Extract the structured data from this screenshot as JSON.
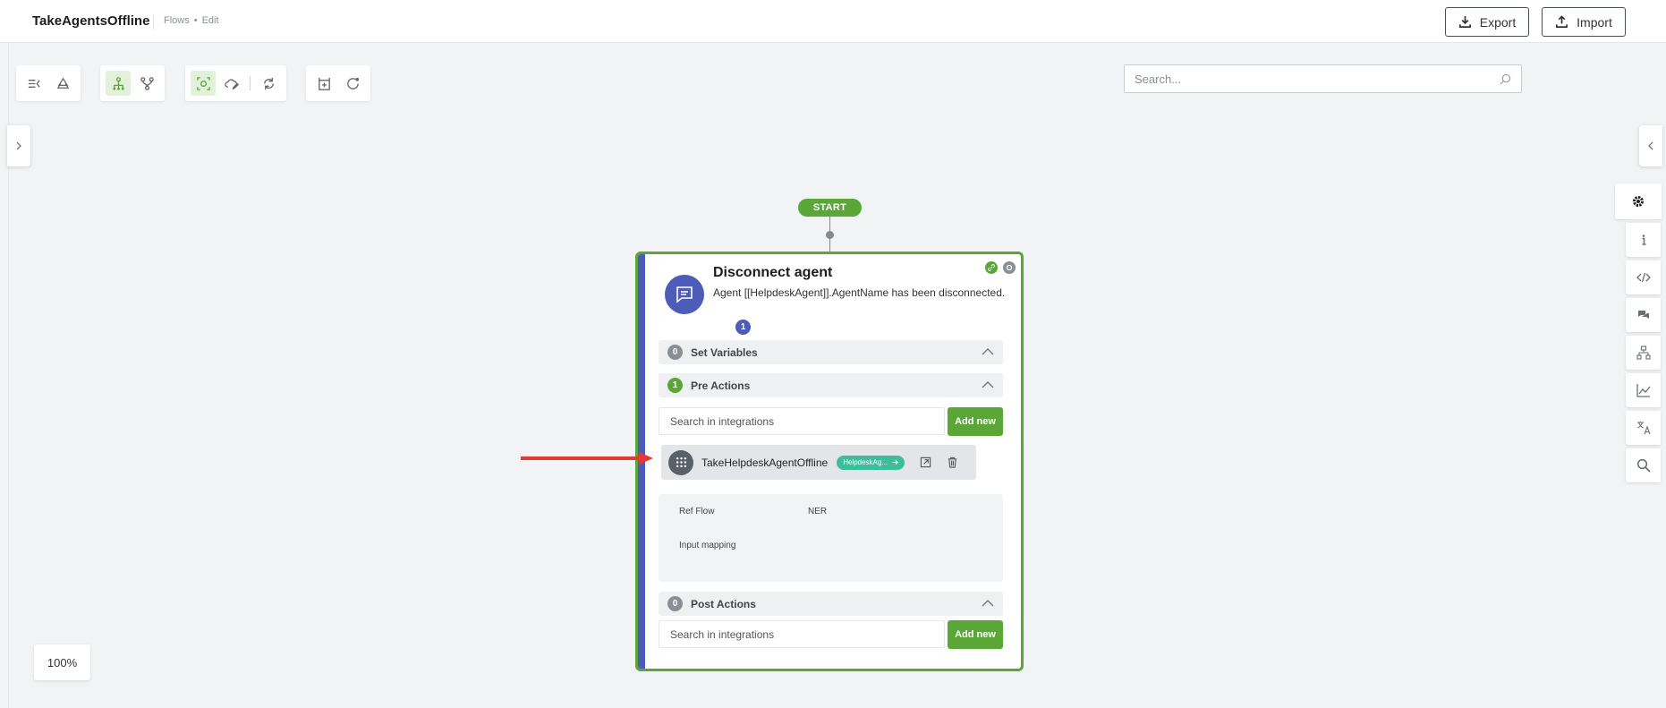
{
  "header": {
    "title": "TakeAgentsOffline",
    "crumb_section": "Flows",
    "crumb_page": "Edit",
    "export_label": "Export",
    "import_label": "Import"
  },
  "search": {
    "placeholder": "Search..."
  },
  "zoom": {
    "level": "100%"
  },
  "flow": {
    "start_label": "START",
    "node": {
      "title": "Disconnect agent",
      "description": "Agent [[HelpdeskAgent]].AgentName has been disconnected.",
      "message_count": "1",
      "sections": {
        "set_variables": {
          "label": "Set Variables",
          "count": "0"
        },
        "pre_actions": {
          "label": "Pre Actions",
          "count": "1"
        },
        "post_actions": {
          "label": "Post Actions",
          "count": "0"
        }
      },
      "integration_search_placeholder": "Search in integrations",
      "add_new_label": "Add new",
      "integration": {
        "name": "TakeHelpdeskAgentOffline",
        "tag": "HelpdeskAg..."
      },
      "details": {
        "ref_flow_label": "Ref Flow",
        "ref_flow_value": "NER",
        "input_mapping_label": "Input mapping"
      }
    }
  },
  "colors": {
    "accent_green": "#5aa637",
    "node_blue": "#4c5cb8",
    "tag_teal": "#3bbf9a",
    "arrow_red": "#e53935"
  },
  "icons": {
    "toolbar": [
      "collapse-list-icon",
      "recycle-icon",
      "tree-layout-icon",
      "fork-icon",
      "focus-node-icon",
      "cloud-edit-icon",
      "refresh-icon",
      "add-node-icon",
      "reset-icon"
    ],
    "right_panel": [
      "gear-icon",
      "info-icon",
      "code-icon",
      "chat-icon",
      "tree-icon",
      "chart-icon",
      "translate-icon",
      "search-icon"
    ]
  }
}
